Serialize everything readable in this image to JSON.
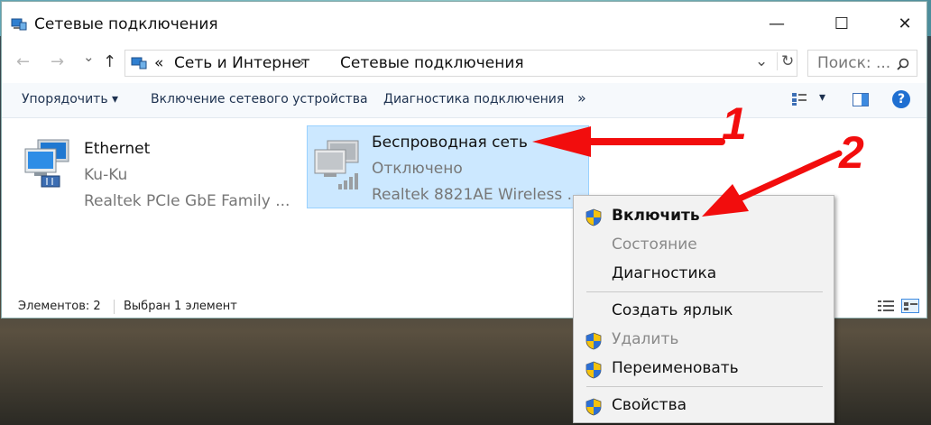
{
  "window": {
    "title": "Сетевые подключения",
    "controls": {
      "minimize": "—",
      "maximize": "☐",
      "close": "✕"
    }
  },
  "address": {
    "back": "←",
    "forward": "→",
    "recent": "⌄",
    "up": "↑",
    "overflow": "«",
    "path": [
      "Сеть и Интернет",
      "Сетевые подключения"
    ],
    "separator": "›",
    "dropdown": "⌄",
    "refresh": "↻",
    "search_placeholder": "Поиск: ...",
    "search_icon": "search-icon"
  },
  "toolbar": {
    "organize": "Упорядочить ▾",
    "enable_device": "Включение сетевого устройства",
    "diagnose": "Диагностика подключения",
    "more": "»",
    "view_dropdown": "▾",
    "help": "?"
  },
  "connections": [
    {
      "name": "Ethernet",
      "status": "Ku-Ku",
      "device": "Realtek PCIe GbE Family ..."
    },
    {
      "name": "Беспроводная сеть",
      "status": "Отключено",
      "device": "Realtek 8821AE Wireless ..."
    }
  ],
  "status": {
    "count": "Элементов: 2",
    "selected": "Выбран 1 элемент"
  },
  "context_menu": {
    "items": [
      {
        "label": "Включить",
        "shield": true,
        "bold": true,
        "disabled": false
      },
      {
        "label": "Состояние",
        "shield": false,
        "bold": false,
        "disabled": true
      },
      {
        "label": "Диагностика",
        "shield": false,
        "bold": false,
        "disabled": false
      },
      {
        "label": "Создать ярлык",
        "shield": false,
        "bold": false,
        "disabled": false
      },
      {
        "label": "Удалить",
        "shield": true,
        "bold": false,
        "disabled": true
      },
      {
        "label": "Переименовать",
        "shield": true,
        "bold": false,
        "disabled": false
      },
      {
        "label": "Свойства",
        "shield": true,
        "bold": false,
        "disabled": false
      }
    ]
  },
  "annotations": {
    "first": "1",
    "second": "2"
  },
  "colors": {
    "accent": "#0078d7",
    "selection": "#cce8ff",
    "annotation": "#f20d0d"
  }
}
